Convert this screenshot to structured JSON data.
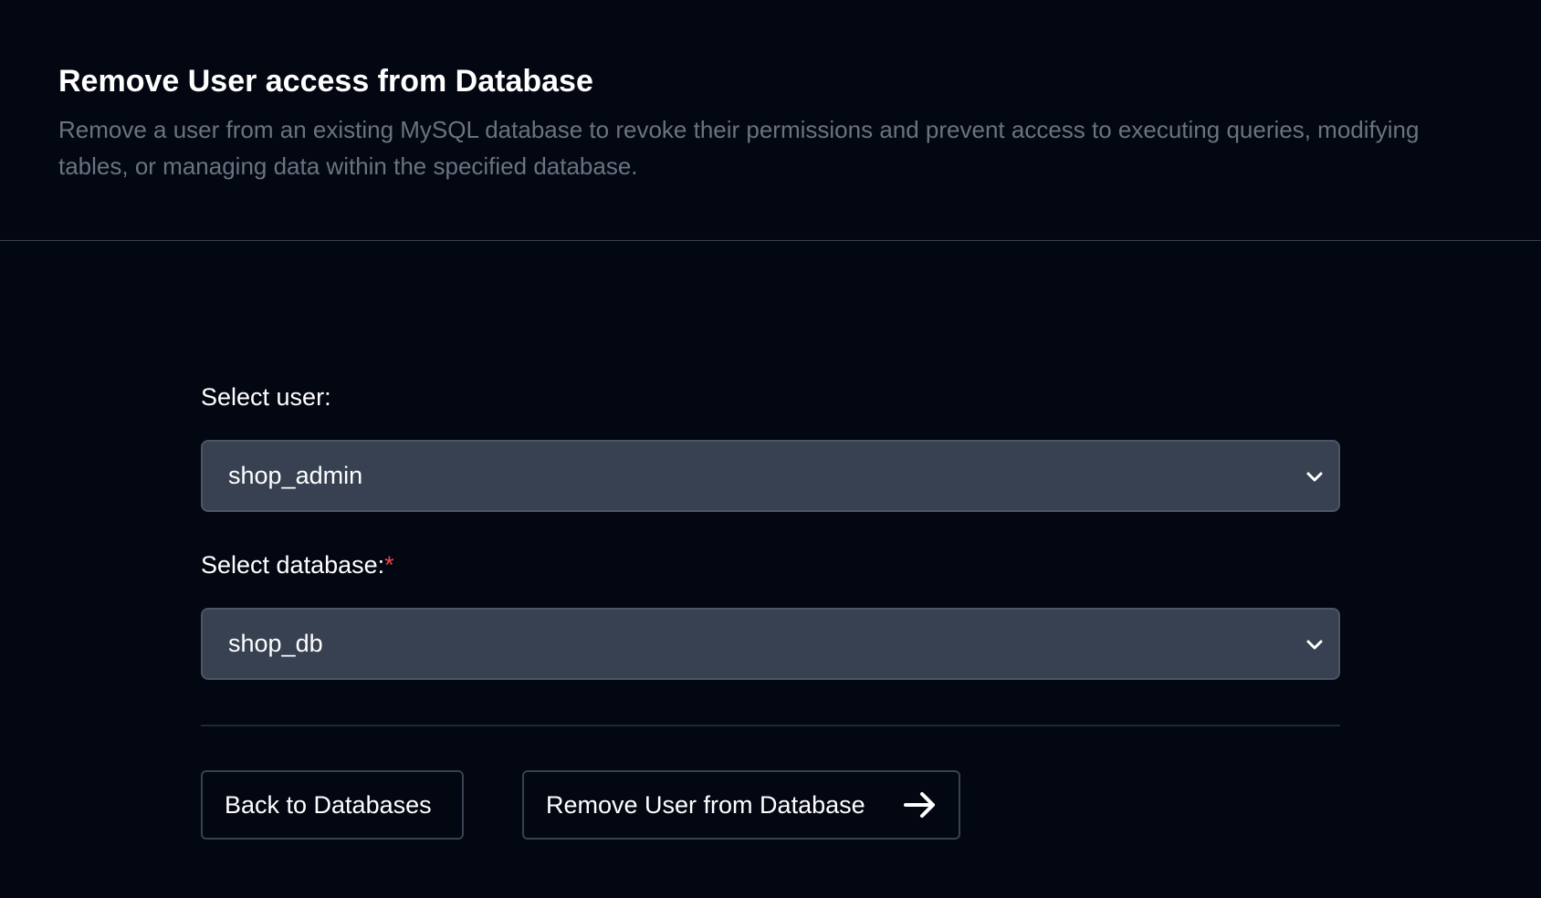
{
  "header": {
    "title": "Remove User access from Database",
    "description": "Remove a user from an existing MySQL database to revoke their permissions and prevent access to executing queries, modifying tables, or managing data within the specified database."
  },
  "form": {
    "user_field": {
      "label": "Select user:",
      "value": "shop_admin",
      "icon": "chevron-down-icon"
    },
    "database_field": {
      "label": "Select database:",
      "required_mark": "*",
      "value": "shop_db",
      "icon": "chevron-down-icon"
    }
  },
  "actions": {
    "back_label": "Back to Databases",
    "remove_label": "Remove User from Database",
    "remove_icon": "arrow-right-icon"
  },
  "colors": {
    "background": "#030712",
    "input_background": "#374151",
    "required": "#ef4444",
    "muted_text": "#6b7280"
  }
}
